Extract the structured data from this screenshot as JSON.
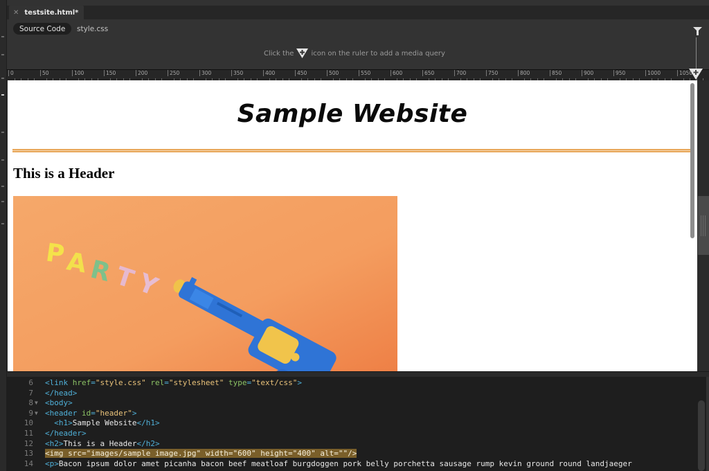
{
  "window": {
    "document_tab": "testsite.html*",
    "close_icon": "close-icon"
  },
  "filebar": {
    "files": [
      {
        "label": "Source Code",
        "active": true
      },
      {
        "label": "style.css",
        "active": false
      }
    ],
    "filter_icon": "filter-icon"
  },
  "media_query_bar": {
    "hint_before": "Click the",
    "hint_icon": "add-media-query-icon",
    "hint_after": "icon on the ruler to add a media query"
  },
  "ruler": {
    "labels": [
      "0",
      "50",
      "100",
      "150",
      "200",
      "250",
      "300",
      "350",
      "400",
      "450",
      "500",
      "550",
      "600",
      "650",
      "700",
      "750",
      "800",
      "850",
      "900",
      "950",
      "1000",
      "1050"
    ],
    "step": 50,
    "handle_icon": "media-query-handle-icon"
  },
  "live_view": {
    "h1": "Sample Website",
    "h2": "This is a Header",
    "image_text": "PARTY",
    "image_subject": "blue toy revolver on orange background with PARTY letters",
    "accent_color": "#e8a75a"
  },
  "code_view": {
    "lines": [
      {
        "n": "6",
        "fold": false,
        "parts": [
          [
            "tag",
            "<link "
          ],
          [
            "attr",
            "href"
          ],
          [
            "tag",
            "="
          ],
          [
            "str",
            "\"style.css\""
          ],
          [
            "txt",
            " "
          ],
          [
            "attr",
            "rel"
          ],
          [
            "tag",
            "="
          ],
          [
            "str",
            "\"stylesheet\""
          ],
          [
            "txt",
            " "
          ],
          [
            "attr",
            "type"
          ],
          [
            "tag",
            "="
          ],
          [
            "str",
            "\"text/css\""
          ],
          [
            "tag",
            ">"
          ]
        ]
      },
      {
        "n": "7",
        "fold": false,
        "parts": [
          [
            "tag",
            "</head>"
          ]
        ]
      },
      {
        "n": "8",
        "fold": true,
        "parts": [
          [
            "tag",
            "<body>"
          ]
        ]
      },
      {
        "n": "9",
        "fold": true,
        "parts": [
          [
            "tag",
            "<header "
          ],
          [
            "attr",
            "id"
          ],
          [
            "tag",
            "="
          ],
          [
            "str",
            "\"header\""
          ],
          [
            "tag",
            ">"
          ]
        ]
      },
      {
        "n": "10",
        "fold": false,
        "parts": [
          [
            "txt",
            "  "
          ],
          [
            "tag",
            "<h1>"
          ],
          [
            "txt",
            "Sample Website"
          ],
          [
            "tag",
            "</h1>"
          ]
        ]
      },
      {
        "n": "11",
        "fold": false,
        "parts": [
          [
            "tag",
            "</header>"
          ]
        ]
      },
      {
        "n": "12",
        "fold": false,
        "parts": [
          [
            "tag",
            "<h2>"
          ],
          [
            "txt",
            "This is a Header"
          ],
          [
            "tag",
            "</h2>"
          ]
        ]
      },
      {
        "n": "13",
        "fold": false,
        "highlight": true,
        "parts": [
          [
            "hl",
            "<img src=\"images/sample image.jpg\" width=\"600\" height=\"400\" alt=\"\"/>"
          ]
        ]
      },
      {
        "n": "14",
        "fold": false,
        "parts": [
          [
            "tag",
            "<p>"
          ],
          [
            "txt",
            "Bacon ipsum dolor amet picanha bacon beef meatloaf burgdoggen pork belly porchetta sausage rump kevin ground round landjaeger"
          ]
        ]
      }
    ]
  }
}
